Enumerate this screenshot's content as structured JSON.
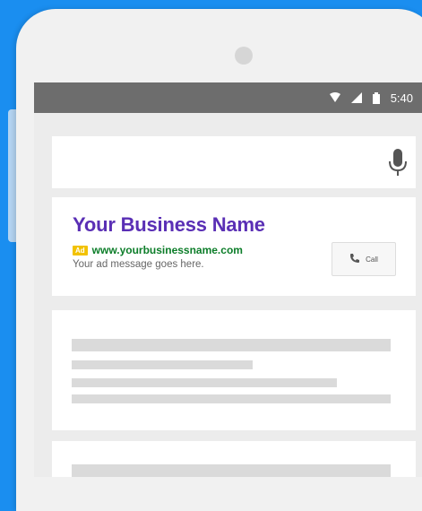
{
  "colors": {
    "background": "#1a8ef0",
    "ad_title": "#5a2fb5",
    "ad_url": "#0c7d29",
    "ad_badge": "#f2c200",
    "status_bar": "#6d6d6d"
  },
  "status_bar": {
    "time": "5:40",
    "icons": [
      "wifi-icon",
      "signal-icon",
      "battery-icon"
    ]
  },
  "search": {
    "icon": "mic-icon"
  },
  "ad": {
    "title": "Your Business Name",
    "badge": "Ad",
    "url": "www.yourbusinessname.com",
    "description": "Your ad message goes here.",
    "call_label": "Call",
    "call_icon": "phone-icon"
  }
}
